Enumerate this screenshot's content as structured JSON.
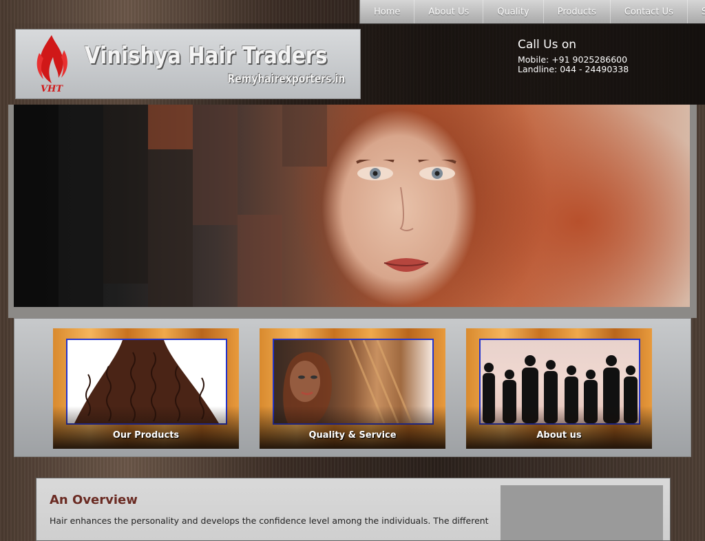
{
  "nav": {
    "items": [
      "Home",
      "About Us",
      "Quality",
      "Products",
      "Contact Us",
      "Sit"
    ]
  },
  "brand": {
    "logo_initials": "VHT",
    "title": "Vinishya Hair Traders",
    "subtitle": "Remyhairexporters.in",
    "flame_color": "#d01818"
  },
  "contact": {
    "title": "Call Us on",
    "mobile": "Mobile: +91 9025286600",
    "landline": "Landline: 044 - 24490338"
  },
  "features": [
    {
      "label": "Our Products"
    },
    {
      "label": "Quality & Service"
    },
    {
      "label": "About us"
    }
  ],
  "overview": {
    "title": "An Overview",
    "text": "Hair enhances the personality and develops the confidence level among the individuals. The different"
  },
  "colors": {
    "accent_title": "#6a2a22",
    "card_border": "#2233cc"
  }
}
